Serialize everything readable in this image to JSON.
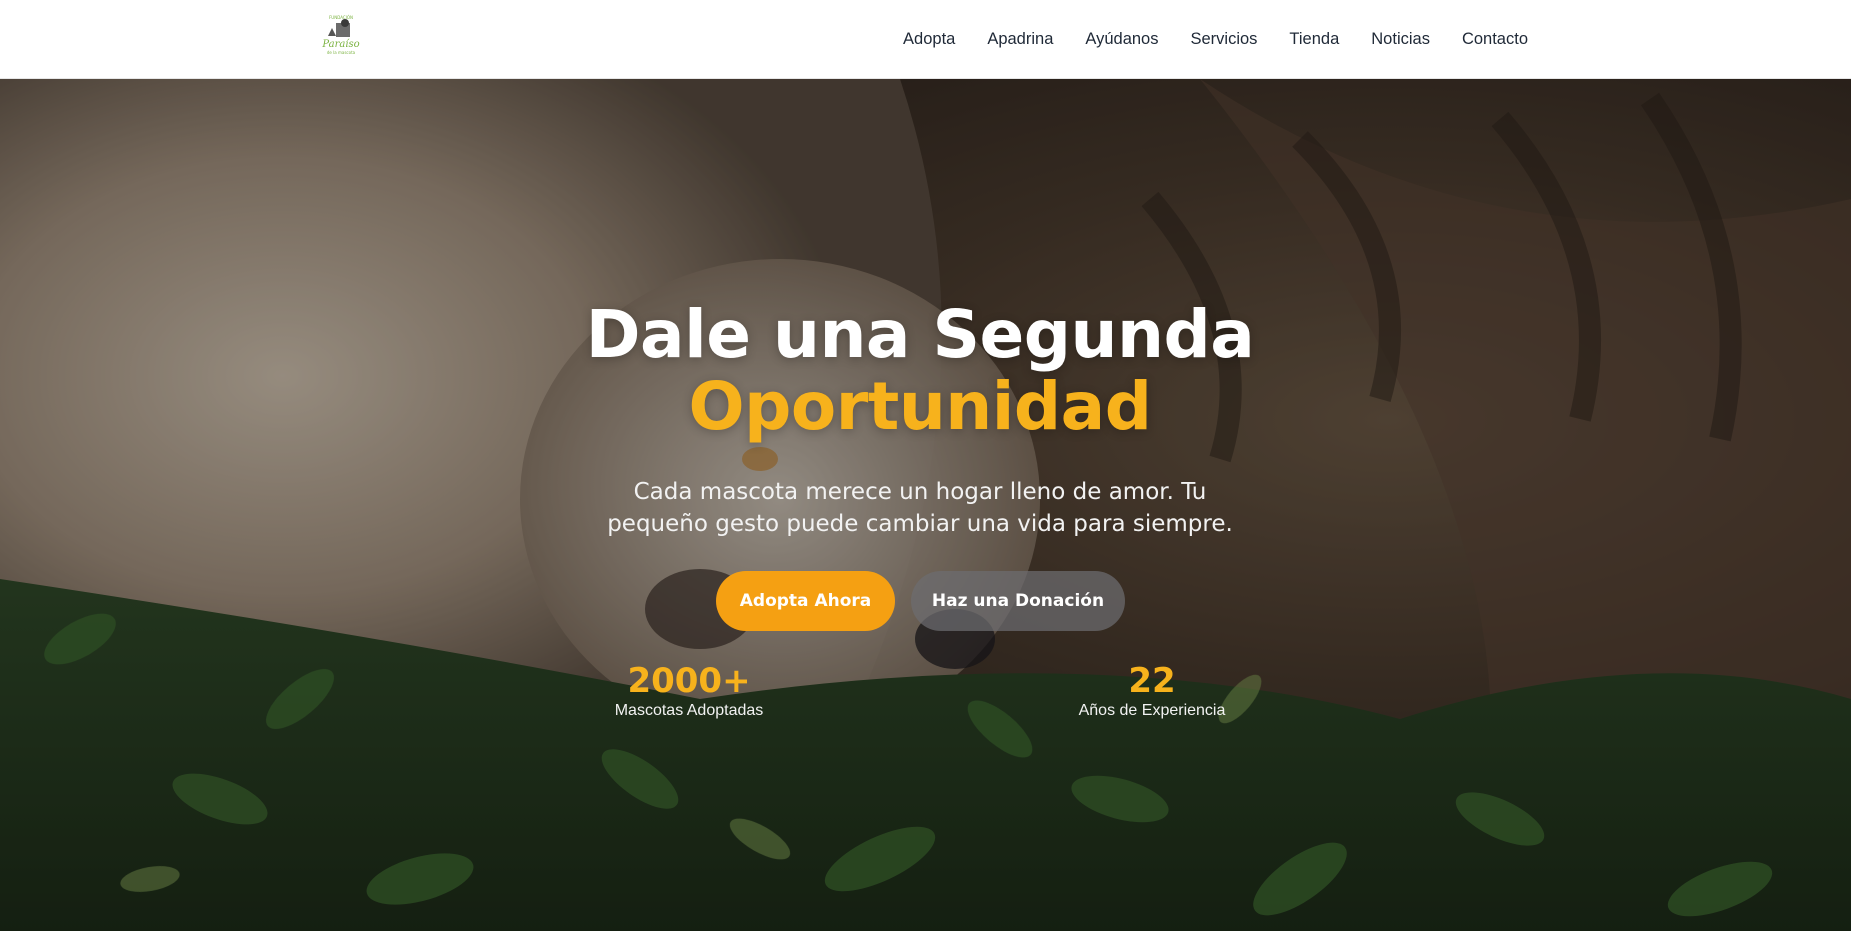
{
  "header": {
    "logo_alt": "Fundación Paraíso de la mascota",
    "logo_text_top": "FUNDACIÓN",
    "logo_text_main": "Paraíso",
    "logo_text_bottom": "de la mascota",
    "nav": [
      {
        "label": "Adopta"
      },
      {
        "label": "Apadrina"
      },
      {
        "label": "Ayúdanos"
      },
      {
        "label": "Servicios"
      },
      {
        "label": "Tienda"
      },
      {
        "label": "Noticias"
      },
      {
        "label": "Contacto"
      }
    ]
  },
  "hero": {
    "title_line1": "Dale una Segunda",
    "title_line2": "Oportunidad",
    "subtitle": "Cada mascota merece un hogar lleno de amor. Tu pequeño gesto puede cambiar una vida para siempre.",
    "primary_button": "Adopta Ahora",
    "secondary_button": "Haz una Donación",
    "stats": [
      {
        "value": "2000+",
        "label": "Mascotas Adoptadas"
      },
      {
        "value": "22",
        "label": "Años de Experiencia"
      }
    ]
  },
  "colors": {
    "accent": "#f7b21c",
    "primary_button": "#f5a012",
    "secondary_button": "#6e6e70",
    "nav_text": "#1f2937",
    "logo_green": "#7cb342"
  }
}
